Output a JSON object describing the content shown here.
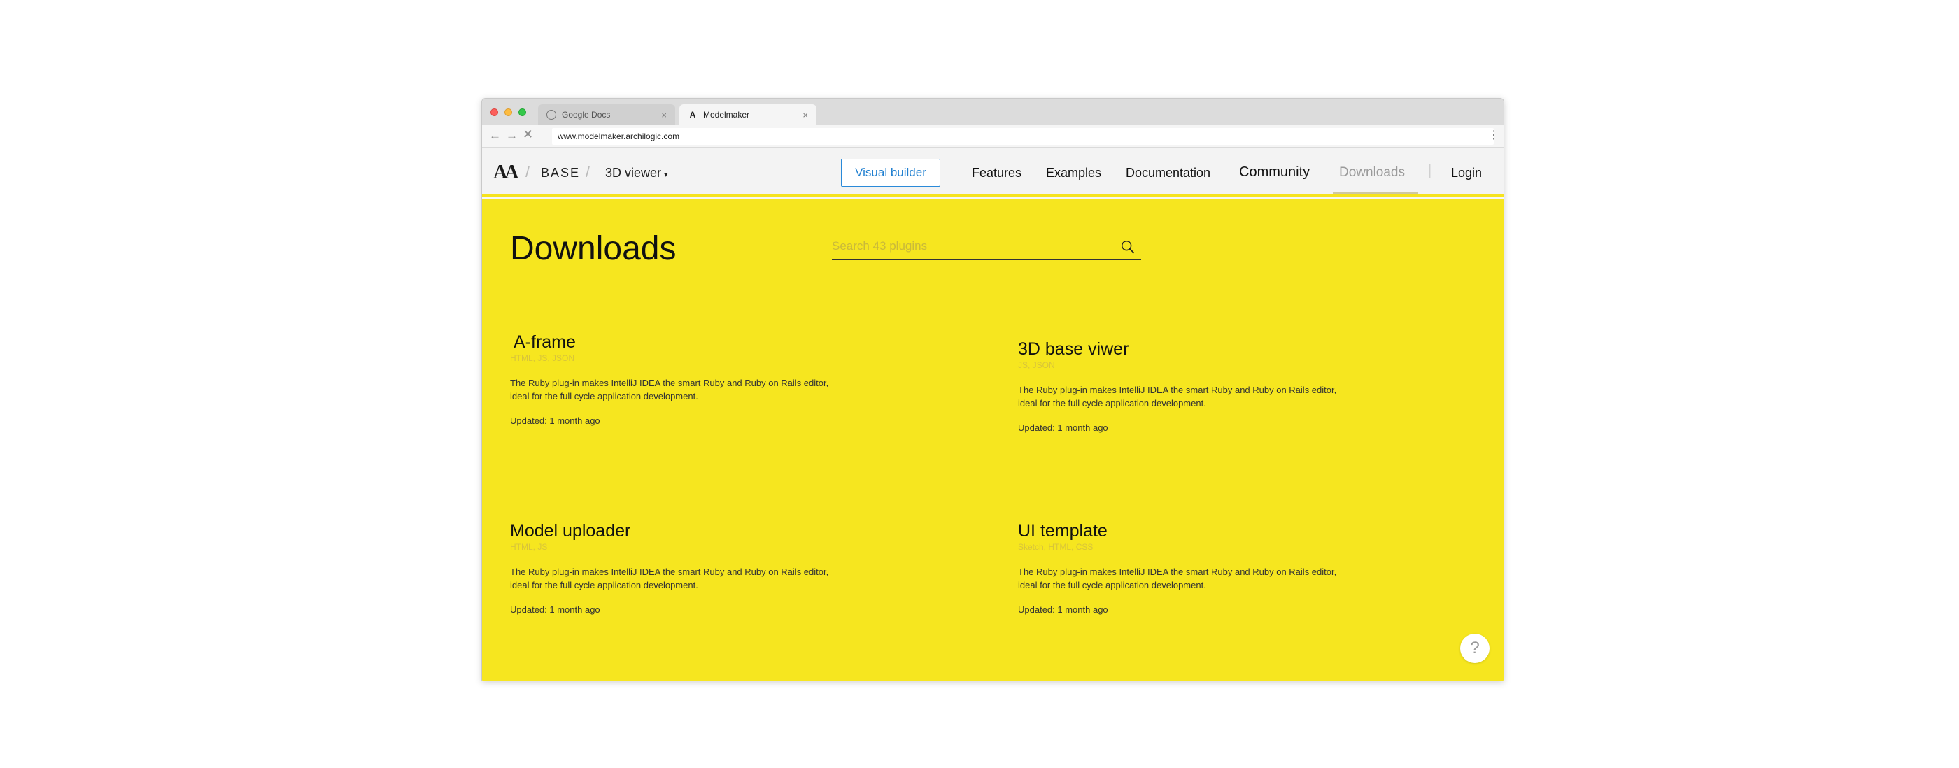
{
  "browser": {
    "tabs": [
      {
        "title": "Google Docs",
        "close": "×",
        "favicon": "globe-icon"
      },
      {
        "title": "Modelmaker",
        "close": "×",
        "favicon": "archilogic-logo-icon"
      }
    ],
    "nav": {
      "back": "←",
      "forward": "→",
      "stop": "✕"
    },
    "url": "www.modelmaker.archilogic.com",
    "menu": "⋮",
    "traffic_colors": {
      "close": "#fc605c",
      "minimize": "#fdbc40",
      "maximize": "#34c84a"
    }
  },
  "header": {
    "logo": "AA",
    "separator": "/",
    "brand": "BASE",
    "viewer_dropdown": "3D viewer",
    "caret": "▾",
    "visual_builder": "Visual builder",
    "nav": {
      "features": "Features",
      "examples": "Examples",
      "documentation": "Documentation",
      "community": "Community",
      "downloads": "Downloads",
      "login": "Login"
    },
    "nav_separator": "|",
    "accent_color": "#f6e61f",
    "button_color": "#1f7fd0"
  },
  "main": {
    "title": "Downloads",
    "search": {
      "placeholder": "Search 43 plugins",
      "value": ""
    },
    "plugins": [
      {
        "title": "A-frame",
        "tags": "HTML, JS, JSON",
        "description": "The Ruby plug-in makes IntelliJ IDEA the smart Ruby and Ruby on Rails editor, ideal for the full cycle application development.",
        "updated": "Updated: 1 month ago"
      },
      {
        "title": "3D base viwer",
        "tags": "JS, JSON",
        "description": "The Ruby plug-in makes IntelliJ IDEA the smart Ruby and Ruby on Rails editor, ideal for the full cycle application development.",
        "updated": "Updated: 1 month ago"
      },
      {
        "title": "Model uploader",
        "tags": "HTML, JS",
        "description": "The Ruby plug-in makes IntelliJ IDEA the smart Ruby and Ruby on Rails editor, ideal for the full cycle application development.",
        "updated": "Updated: 1 month ago"
      },
      {
        "title": "UI template",
        "tags": "Sketch, HTML, CSS",
        "description": "The Ruby plug-in makes IntelliJ IDEA the smart Ruby and Ruby on Rails editor, ideal for the full cycle application development.",
        "updated": "Updated: 1 month ago"
      }
    ],
    "help": "?"
  }
}
